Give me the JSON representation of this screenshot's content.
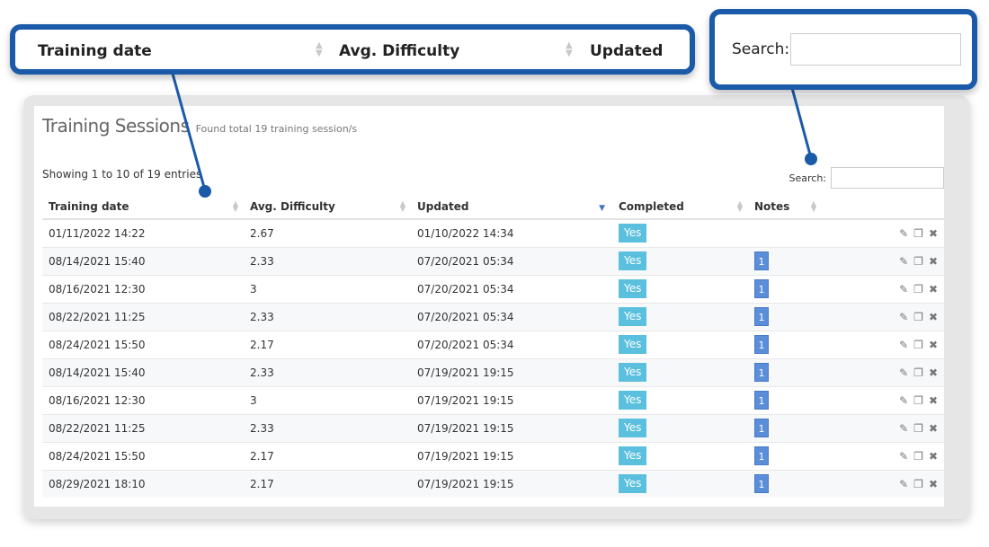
{
  "panel": {
    "title": "Training Sessions",
    "subtitle": "Found total 19 training session/s",
    "showing": "Showing 1 to 10 of 19 entries",
    "search_label": "Search:",
    "search_value": ""
  },
  "table": {
    "headers": [
      "Training date",
      "Avg. Difficulty",
      "Updated",
      "Completed",
      "Notes"
    ],
    "rows": [
      {
        "date": "01/11/2022 14:22",
        "difficulty": "2.67",
        "updated": "01/10/2022 14:34",
        "completed": "Yes",
        "notes": ""
      },
      {
        "date": "08/14/2021 15:40",
        "difficulty": "2.33",
        "updated": "07/20/2021 05:34",
        "completed": "Yes",
        "notes": "1"
      },
      {
        "date": "08/16/2021 12:30",
        "difficulty": "3",
        "updated": "07/20/2021 05:34",
        "completed": "Yes",
        "notes": "1"
      },
      {
        "date": "08/22/2021 11:25",
        "difficulty": "2.33",
        "updated": "07/20/2021 05:34",
        "completed": "Yes",
        "notes": "1"
      },
      {
        "date": "08/24/2021 15:50",
        "difficulty": "2.17",
        "updated": "07/20/2021 05:34",
        "completed": "Yes",
        "notes": "1"
      },
      {
        "date": "08/14/2021 15:40",
        "difficulty": "2.33",
        "updated": "07/19/2021 19:15",
        "completed": "Yes",
        "notes": "1"
      },
      {
        "date": "08/16/2021 12:30",
        "difficulty": "3",
        "updated": "07/19/2021 19:15",
        "completed": "Yes",
        "notes": "1"
      },
      {
        "date": "08/22/2021 11:25",
        "difficulty": "2.33",
        "updated": "07/19/2021 19:15",
        "completed": "Yes",
        "notes": "1"
      },
      {
        "date": "08/24/2021 15:50",
        "difficulty": "2.17",
        "updated": "07/19/2021 19:15",
        "completed": "Yes",
        "notes": "1"
      },
      {
        "date": "08/29/2021 18:10",
        "difficulty": "2.17",
        "updated": "07/19/2021 19:15",
        "completed": "Yes",
        "notes": "1"
      }
    ],
    "icons": [
      "pencil-icon",
      "copy-icon",
      "close-icon"
    ]
  },
  "callout_headers": {
    "h1": "Training date",
    "h2": "Avg. Difficulty",
    "h3": "Updated"
  },
  "callout_search": {
    "label": "Search:"
  },
  "colors": {
    "callout_border": "#1a5aa8",
    "badge_yes": "#5bc0de",
    "badge_notes": "#5b8ed8"
  }
}
